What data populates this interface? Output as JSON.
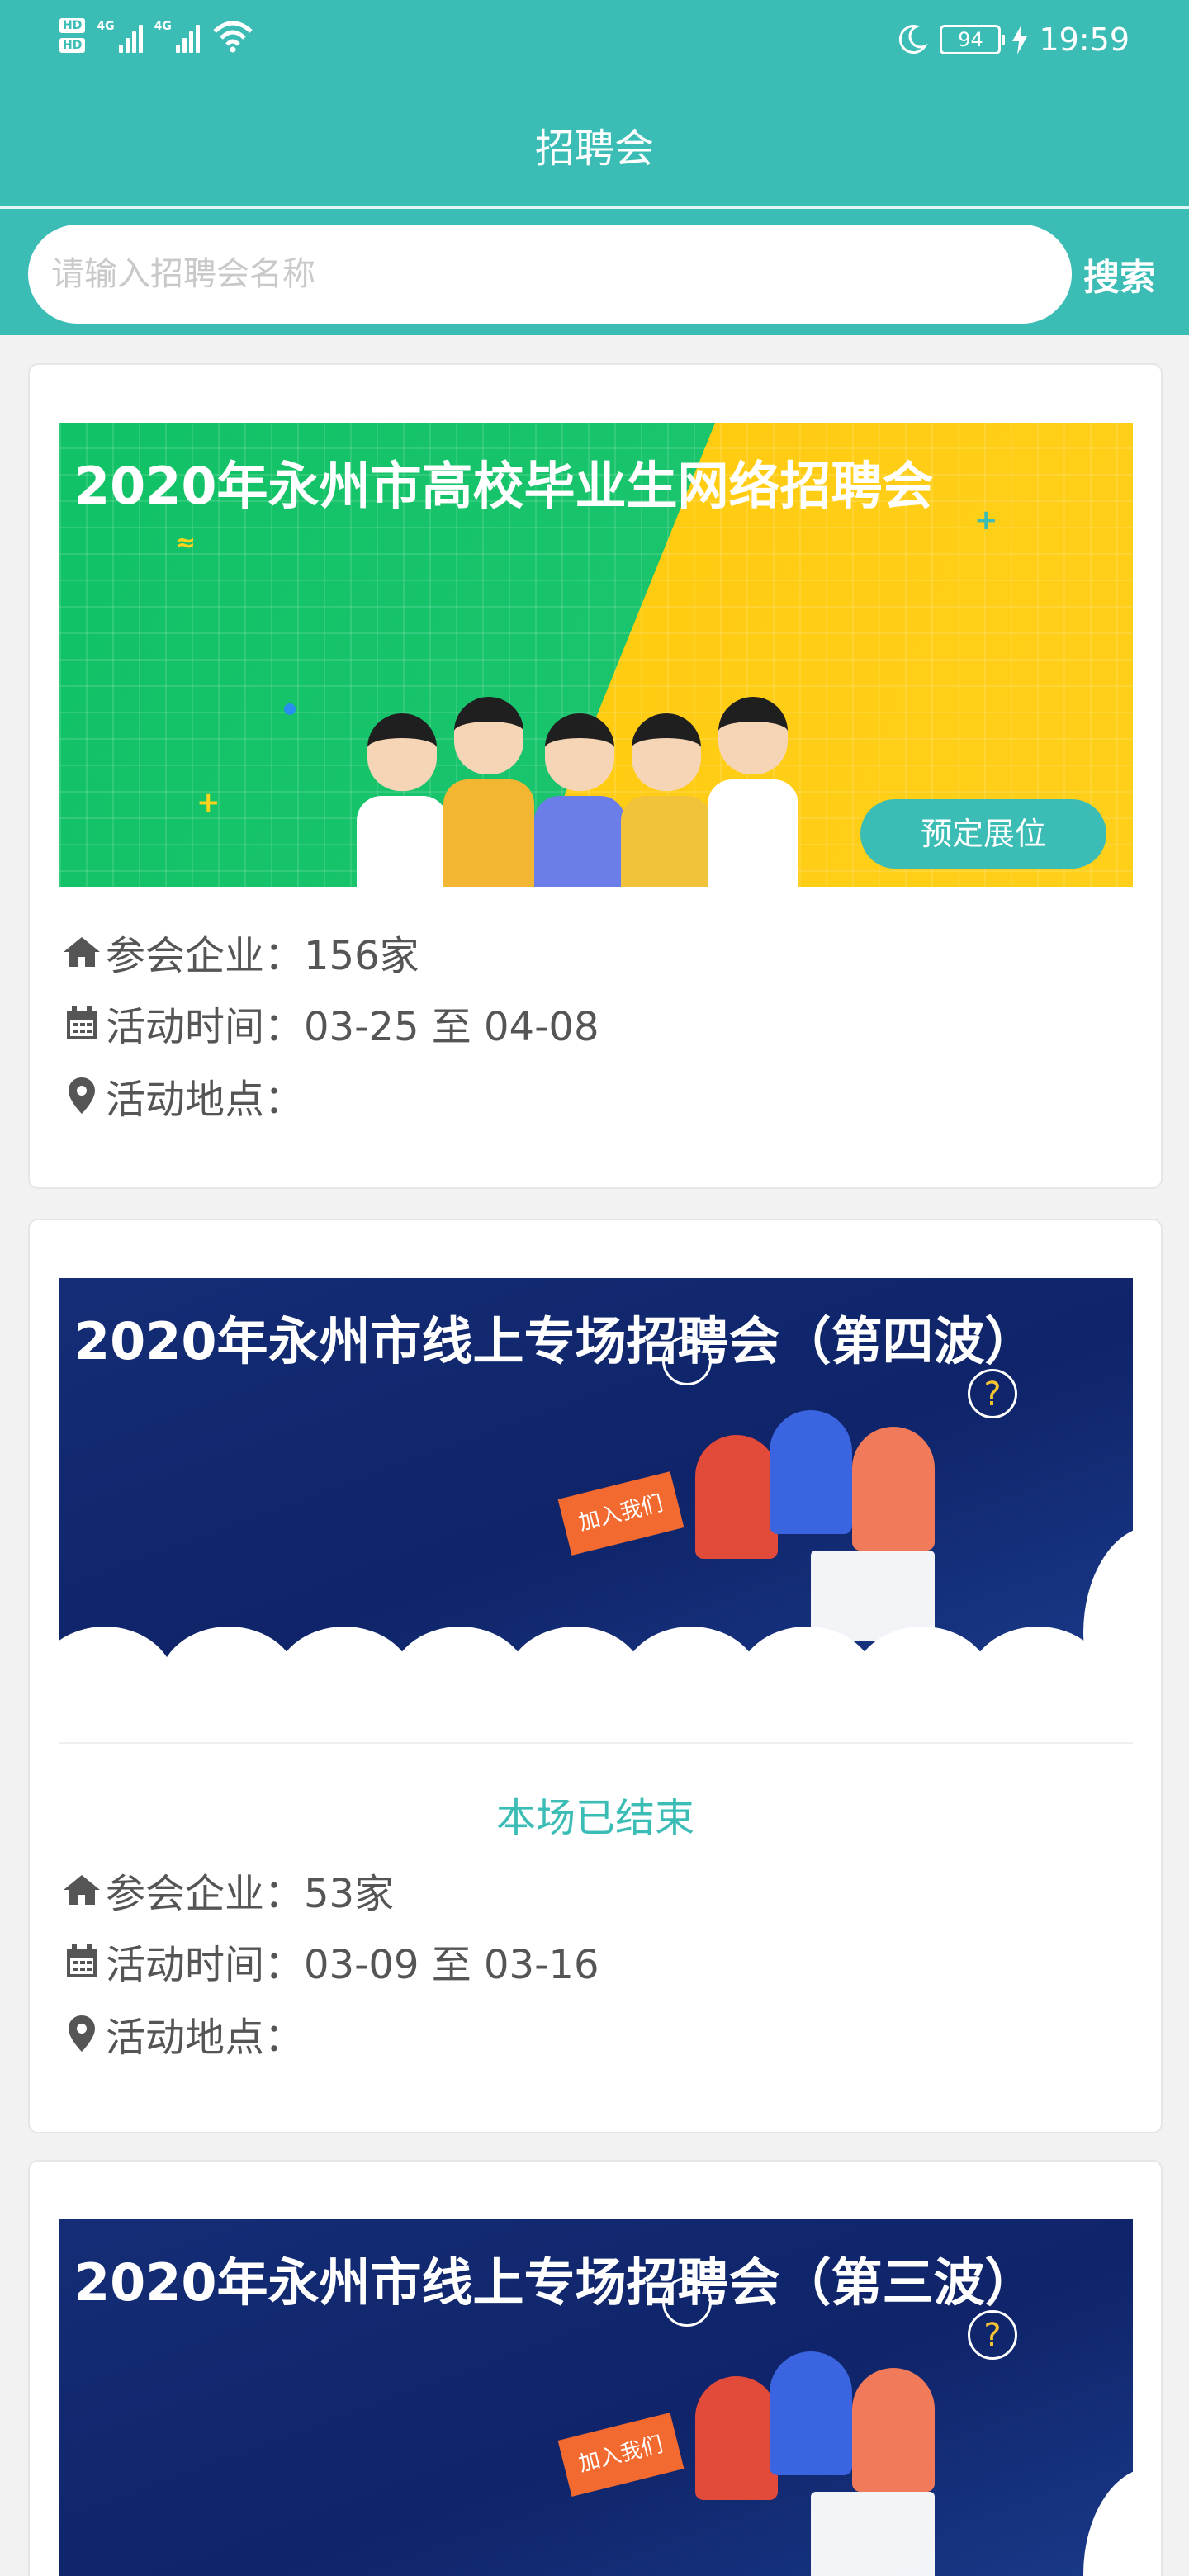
{
  "status_bar": {
    "hd1": "HD",
    "hd2": "HD",
    "sim1": "4G",
    "sim2": "4G",
    "battery": "94",
    "time": "19:59"
  },
  "header": {
    "title": "招聘会"
  },
  "search": {
    "placeholder": "请输入招聘会名称",
    "button": "搜索"
  },
  "fairs": [
    {
      "banner_title": "2020年永州市高校毕业生网络招聘会",
      "book_button": "预定展位",
      "status": "",
      "companies_label": "参会企业：",
      "companies_value": "156家",
      "time_label": "活动时间：",
      "time_value": "03-25 至 04-08",
      "place_label": "活动地点：",
      "place_value": ""
    },
    {
      "banner_title": "2020年永州市线上专场招聘会（第四波）",
      "banner_sign": "加入我们",
      "status": "本场已结束",
      "companies_label": "参会企业：",
      "companies_value": "53家",
      "time_label": "活动时间：",
      "time_value": "03-09 至 03-16",
      "place_label": "活动地点：",
      "place_value": ""
    },
    {
      "banner_title": "2020年永州市线上专场招聘会（第三波）",
      "banner_sign": "加入我们"
    }
  ],
  "colors": {
    "primary": "#3bbdb6",
    "banner_green": "#11c266",
    "banner_yellow": "#ffcc12",
    "banner_blue": "#142d76"
  }
}
